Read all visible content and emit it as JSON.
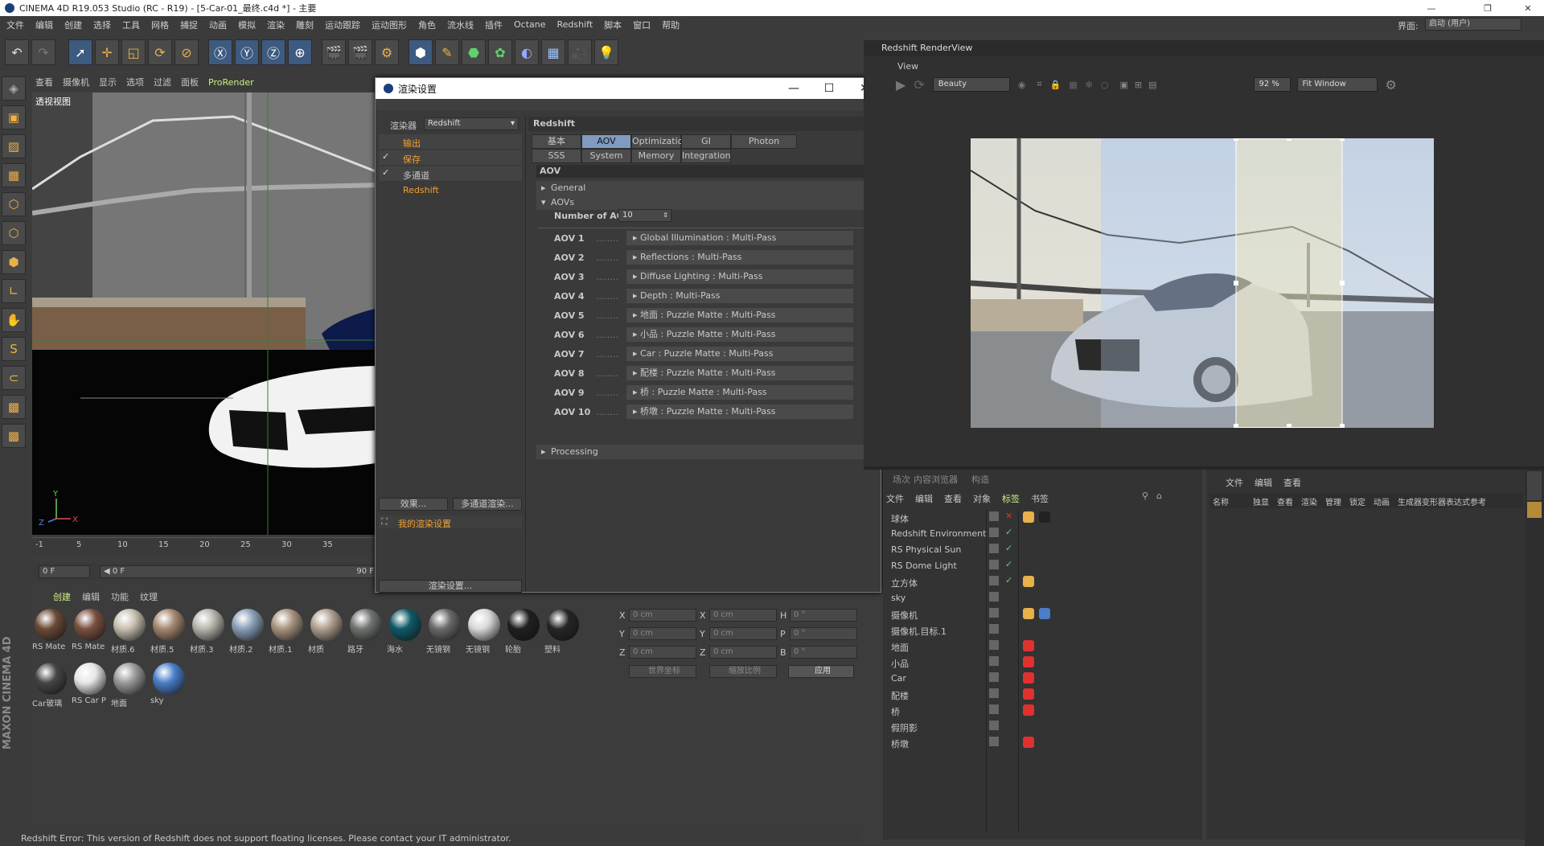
{
  "window": {
    "title": "CINEMA 4D R19.053 Studio (RC - R19) - [5-Car-01_最终.c4d *] - 主要"
  },
  "menu": [
    "文件",
    "编辑",
    "创建",
    "选择",
    "工具",
    "网格",
    "捕捉",
    "动画",
    "模拟",
    "渲染",
    "雕刻",
    "运动跟踪",
    "运动图形",
    "角色",
    "流水线",
    "插件",
    "Octane",
    "Redshift",
    "脚本",
    "窗口",
    "帮助"
  ],
  "layout": {
    "label": "界面:",
    "value": "启动 (用户)"
  },
  "viewport": {
    "menu": [
      "查看",
      "摄像机",
      "显示",
      "选项",
      "过滤",
      "面板",
      "ProRender"
    ],
    "label": "透视视图"
  },
  "timeline": {
    "ticks": [
      "-1",
      "5",
      "10",
      "15",
      "20",
      "25",
      "30",
      "35"
    ],
    "start": "0 F",
    "slider_start": "0 F",
    "slider_end": "90 F"
  },
  "materials": {
    "menu": [
      "创建",
      "编辑",
      "功能",
      "纹理"
    ],
    "items": [
      {
        "name": "RS Mate",
        "color": "#6b4a36"
      },
      {
        "name": "RS Mate",
        "color": "#7a5040"
      },
      {
        "name": "材质.6",
        "color": "#c8c0b0"
      },
      {
        "name": "材质.5",
        "color": "#a58870"
      },
      {
        "name": "材质.3",
        "color": "#b8b6ac"
      },
      {
        "name": "材质.2",
        "color": "#8a9fb8"
      },
      {
        "name": "材质.1",
        "color": "#a89480"
      },
      {
        "name": "材质",
        "color": "#b0a090"
      },
      {
        "name": "路牙",
        "color": "#707470"
      },
      {
        "name": "海水",
        "color": "#0e5a68"
      },
      {
        "name": "无镜钢",
        "color": "#6a6a6a"
      },
      {
        "name": "无镜钢",
        "color": "#d8d8d8"
      },
      {
        "name": "轮胎",
        "color": "#202020"
      },
      {
        "name": "塑料",
        "color": "#262626"
      },
      {
        "name": "Car玻璃",
        "color": "#454545"
      },
      {
        "name": "RS Car P",
        "color": "#e6e6e6"
      },
      {
        "name": "地面",
        "color": "#9a9a9a"
      },
      {
        "name": "sky",
        "color": "#4a7ec9"
      }
    ]
  },
  "coords": {
    "rows": [
      {
        "a": "X",
        "av": "0 cm",
        "b": "X",
        "bv": "0 cm",
        "c": "H",
        "cv": "0 °"
      },
      {
        "a": "Y",
        "av": "0 cm",
        "b": "Y",
        "bv": "0 cm",
        "c": "P",
        "cv": "0 °"
      },
      {
        "a": "Z",
        "av": "0 cm",
        "b": "Z",
        "bv": "0 cm",
        "c": "B",
        "cv": "0 °"
      }
    ],
    "mode1": "世界坐标",
    "mode2": "缩放比例",
    "apply": "应用"
  },
  "dialog": {
    "title": "渲染设置",
    "renderer_label": "渲染器",
    "renderer_value": "Redshift",
    "tree": [
      {
        "label": "输出",
        "checked": false
      },
      {
        "label": "保存",
        "checked": true
      },
      {
        "label": "多通道",
        "checked": true
      },
      {
        "label": "Redshift",
        "checked": false
      }
    ],
    "effects_btn": "效果...",
    "multipass_btn": "多通道渲染...",
    "preset": "我的渲染设置",
    "settings_btn": "渲染设置...",
    "header": "Redshift",
    "tabs_row1": [
      "基本",
      "AOV",
      "Optimization",
      "GI",
      "Photon"
    ],
    "tabs_row2": [
      "SSS",
      "System",
      "Memory",
      "Integration"
    ],
    "section": "AOV",
    "general": "General",
    "aovs": "AOVs",
    "num_label": "Number of AOVs",
    "num_value": "10",
    "aov_list": [
      {
        "k": "AOV 1",
        "v": "Global Illumination : Multi-Pass"
      },
      {
        "k": "AOV 2",
        "v": "Reflections : Multi-Pass"
      },
      {
        "k": "AOV 3",
        "v": "Diffuse Lighting : Multi-Pass"
      },
      {
        "k": "AOV 4",
        "v": "Depth : Multi-Pass"
      },
      {
        "k": "AOV 5",
        "v": "地面 : Puzzle Matte : Multi-Pass"
      },
      {
        "k": "AOV 6",
        "v": "小品 : Puzzle Matte : Multi-Pass"
      },
      {
        "k": "AOV 7",
        "v": "Car : Puzzle Matte : Multi-Pass"
      },
      {
        "k": "AOV 8",
        "v": "配楼 : Puzzle Matte : Multi-Pass"
      },
      {
        "k": "AOV 9",
        "v": "桥 : Puzzle Matte : Multi-Pass"
      },
      {
        "k": "AOV 10",
        "v": "桥墩 : Puzzle Matte : Multi-Pass"
      }
    ],
    "processing": "Processing"
  },
  "renderview": {
    "title": "Redshift RenderView",
    "menu": "View",
    "pass": "Beauty",
    "zoom": "92 %",
    "fit": "Fit Window"
  },
  "object_manager": {
    "tabs": [
      "场次",
      "内容浏览器",
      "构造"
    ],
    "menu": [
      "文件",
      "编辑",
      "查看",
      "对象",
      "标签",
      "书签"
    ],
    "objects": [
      "球体",
      "Redshift Environment",
      "RS Physical Sun",
      "RS Dome Light",
      "立方体",
      "sky",
      "摄像机",
      "摄像机.目标.1",
      "地面",
      "小品",
      "Car",
      "配楼",
      "桥",
      "假阴影",
      "桥墩"
    ]
  },
  "attributes": {
    "menu": [
      "文件",
      "编辑",
      "查看"
    ],
    "columns": [
      "名称",
      "独显",
      "查看",
      "渲染",
      "管理",
      "锁定",
      "动画",
      "生成器",
      "变形器",
      "表达式",
      "参考"
    ]
  },
  "status": "Redshift Error: This version of Redshift does not support floating licenses. Please contact your IT administrator."
}
